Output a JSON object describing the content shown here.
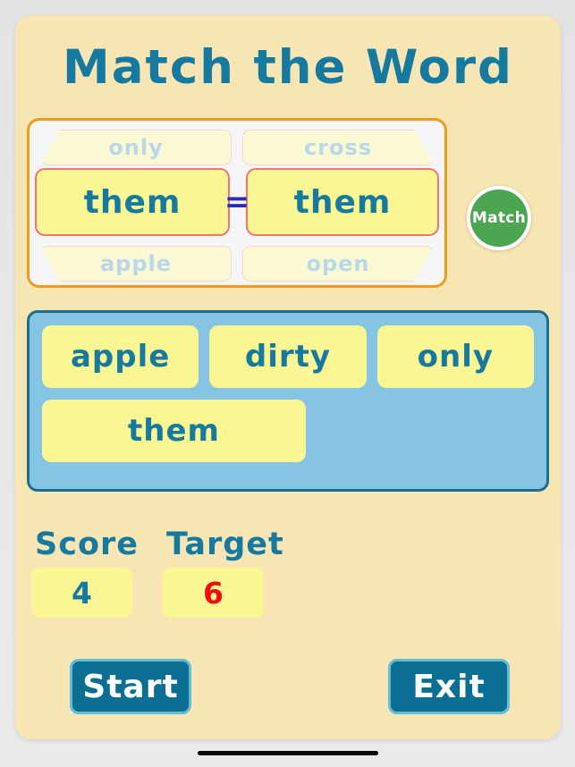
{
  "app": {
    "title": "Match the Word",
    "theme": {
      "panel_bg": "#f7e5b4",
      "accent_blue": "#1579a0",
      "tile_yellow": "#fbf694",
      "picker_border": "#f09a1f",
      "bank_bg": "#85c4e3",
      "bank_border": "#1b6e8c",
      "match_green": "#4ca551",
      "target_red": "#f70a0a",
      "button_teal": "#0b6f93",
      "button_border": "#62bcd8"
    }
  },
  "picker": {
    "equals_symbol": "=",
    "left_column": {
      "above": "only",
      "selected": "them",
      "below": "apple"
    },
    "right_column": {
      "above": "cross",
      "selected": "them",
      "below": "open"
    }
  },
  "match_button": {
    "label": "Match"
  },
  "word_bank": {
    "rows": [
      [
        "apple",
        "dirty",
        "only"
      ],
      [
        "them"
      ]
    ]
  },
  "stats": {
    "score": {
      "label": "Score",
      "value": "4"
    },
    "target": {
      "label": "Target",
      "value": "6"
    }
  },
  "actions": {
    "start_label": "Start",
    "exit_label": "Exit"
  }
}
